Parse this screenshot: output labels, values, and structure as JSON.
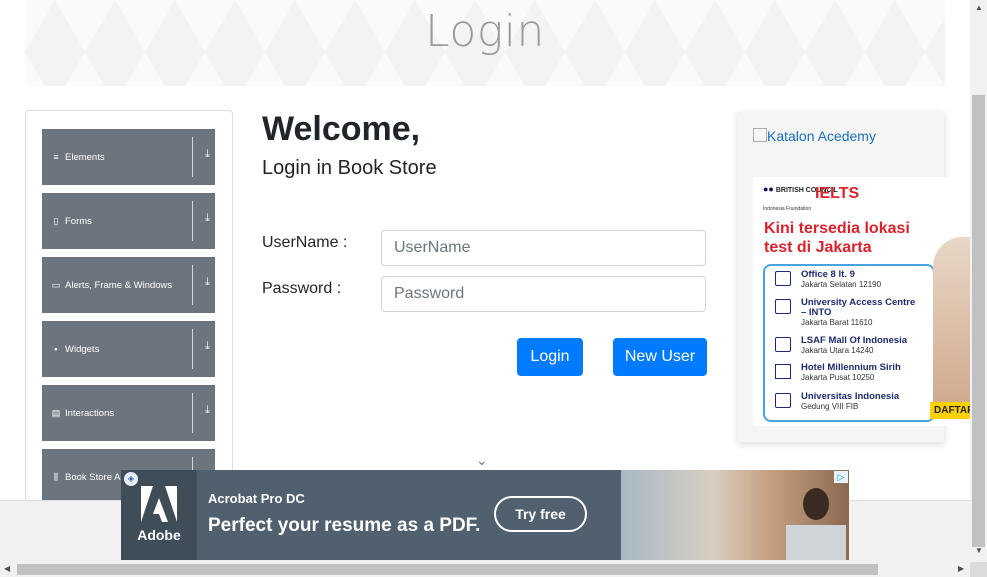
{
  "banner": {
    "title": "Login"
  },
  "sidebar": {
    "groups": [
      {
        "icon": "bars-icon",
        "glyph": "≡",
        "label": "Elements"
      },
      {
        "icon": "form-icon",
        "glyph": "▯",
        "label": "Forms"
      },
      {
        "icon": "window-icon",
        "glyph": "▭",
        "label": "Alerts, Frame & Windows"
      },
      {
        "icon": "grid-icon",
        "glyph": "▪",
        "label": "Widgets"
      },
      {
        "icon": "list-icon",
        "glyph": "▤",
        "label": "Interactions"
      },
      {
        "icon": "books-icon",
        "glyph": "⫼",
        "label": "Book Store A"
      }
    ],
    "expand_glyph": "⤓"
  },
  "main": {
    "welcome": "Welcome,",
    "subtitle": "Login in Book Store",
    "username_label": "UserName :",
    "username_placeholder": "UserName",
    "password_label": "Password :",
    "password_placeholder": "Password",
    "login_button": "Login",
    "new_user_button": "New User",
    "scroll_chevron": "⌄"
  },
  "right_ad": {
    "broken_image_alt": "Katalon Acedemy",
    "brand": "BRITISH COUNCIL",
    "brand_sub": "Indonesia Foundation",
    "logo": "IELTS",
    "headline": "Kini tersedia lokasi test di Jakarta",
    "locations": [
      {
        "name": "Office 8 lt. 9",
        "address": "Jakarta Selatan 12190"
      },
      {
        "name": "University Access Centre – INTO",
        "address": "Jakarta Barat 11610"
      },
      {
        "name": "LSAF Mall Of Indonesia",
        "address": "Jakarta Utara 14240"
      },
      {
        "name": "Hotel Millennium Sirih",
        "address": "Jakarta Pusat 10250"
      },
      {
        "name": "Universitas Indonesia",
        "address": "Gedung VIII FIB"
      }
    ],
    "cta": "DAFTAR"
  },
  "bottom_ad": {
    "brand": "Adobe",
    "product": "Acrobat Pro DC",
    "headline": "Perfect your resume as a PDF.",
    "cta": "Try free",
    "colors": {
      "background": "#50606e",
      "logo_box": "#3f4d59"
    }
  },
  "colors": {
    "primary": "#007bff",
    "sidebar_group": "#6c757d",
    "ielts_red": "#d9232d"
  }
}
